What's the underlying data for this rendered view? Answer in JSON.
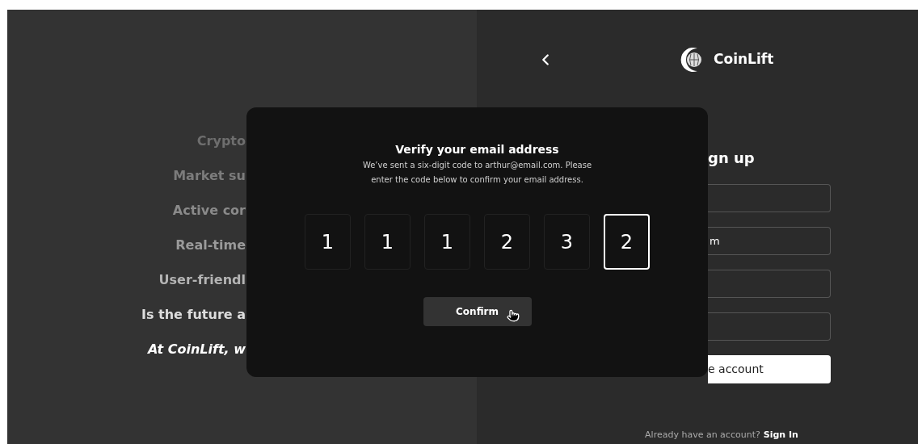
{
  "left_panel": {
    "lines": [
      {
        "text": "Crypto",
        "color": "#6e6e6e",
        "kind": "plain"
      },
      {
        "text": "Market su",
        "color": "#7c7c7c",
        "kind": "plain"
      },
      {
        "text": "Active cor",
        "color": "#8a8a8a",
        "kind": "plain"
      },
      {
        "text": "Real-time",
        "color": "#9a9a9a",
        "kind": "plain"
      },
      {
        "text": "User-friendl",
        "color": "#b4b4b4",
        "kind": "plain"
      },
      {
        "text": "Is the future a",
        "color": "#dddddd",
        "kind": "plain"
      },
      {
        "text": "At CoinLift, w",
        "color": "#ffffff",
        "kind": "emphasis"
      }
    ]
  },
  "header": {
    "brand": "CoinLift"
  },
  "signup": {
    "title": "gn up",
    "fields": [
      {
        "kind": "text"
      },
      {
        "kind": "text",
        "value": "m"
      },
      {
        "kind": "text"
      },
      {
        "kind": "text"
      }
    ],
    "submit": "e account",
    "footer": {
      "text": "Already have an account?",
      "link": "Sign In"
    }
  },
  "dialog": {
    "title": "Verify your email address",
    "message": "We’ve sent a six-digit code to arthur@email.com. Please enter the code below to confirm your email address.",
    "digits": [
      {
        "value": "1",
        "selected": false
      },
      {
        "value": "1",
        "selected": false
      },
      {
        "value": "1",
        "selected": false
      },
      {
        "value": "2",
        "selected": false
      },
      {
        "value": "3",
        "selected": false
      },
      {
        "value": "2",
        "selected": true
      }
    ],
    "confirm": "Confirm"
  }
}
